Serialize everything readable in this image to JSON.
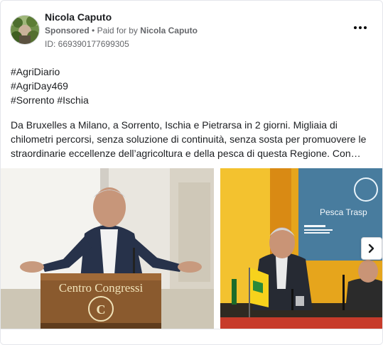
{
  "advertiser": {
    "name": "Nicola Caputo",
    "sponsored_label": "Sponsored",
    "separator": "•",
    "paid_for_prefix": "Paid for by",
    "paid_for_name": "Nicola Caputo",
    "ad_id": "ID: 669390177699305"
  },
  "menu": {
    "icon": "more-horizontal-icon"
  },
  "post": {
    "hashtag_lines": [
      "#AgriDiario",
      "#AgriDay469",
      "#Sorrento #Ischia"
    ],
    "body_lines": [
      "Da Bruxelles a Milano, a Sorrento, Ischia e Pietrarsa in 2 giorni. Migliaia di",
      "chilometri percorsi, senza soluzione di continuità, senza sosta per promuovere le",
      "straordinarie eccellenze dell’agricoltura e della pesca di questa Regione. Con…"
    ]
  },
  "carousel": {
    "slide1": {
      "podium_text": "Centro Congressi",
      "emblem_letter": "C"
    },
    "slide2": {
      "screen_text": "Pesca Trasp"
    },
    "next_icon": "chevron-right-icon"
  },
  "colors": {
    "text_primary": "#1c1e21",
    "text_secondary": "#65676b",
    "border": "#e4e6eb"
  }
}
